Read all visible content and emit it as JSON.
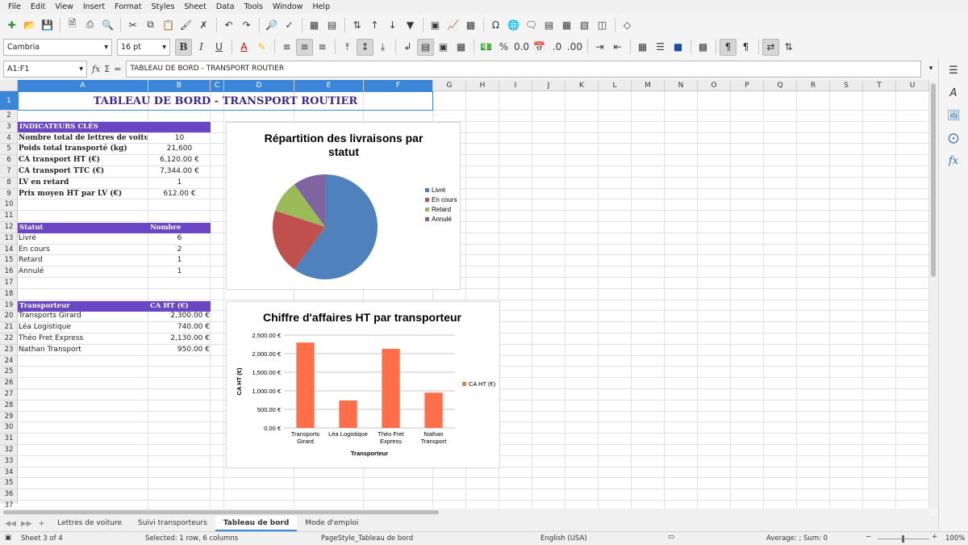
{
  "menu": [
    "File",
    "Edit",
    "View",
    "Insert",
    "Format",
    "Styles",
    "Sheet",
    "Data",
    "Tools",
    "Window",
    "Help"
  ],
  "toolbar2": {
    "font_name": "Cambria",
    "font_size": "16 pt"
  },
  "formula_bar": {
    "name_box": "A1:F1",
    "content": "TABLEAU DE BORD - TRANSPORT ROUTIER"
  },
  "columns": [
    "A",
    "B",
    "C",
    "D",
    "E",
    "F",
    "G",
    "H",
    "I",
    "J",
    "K",
    "L",
    "M",
    "N",
    "O",
    "P",
    "Q",
    "R",
    "S",
    "T",
    "U"
  ],
  "rows": [
    "1",
    "2",
    "3",
    "4",
    "5",
    "6",
    "7",
    "8",
    "9",
    "10",
    "11",
    "12",
    "13",
    "14",
    "15",
    "16",
    "17",
    "18",
    "19",
    "20",
    "21",
    "22",
    "23",
    "24",
    "25",
    "26",
    "27",
    "28",
    "29",
    "30",
    "31",
    "32",
    "33",
    "34",
    "35",
    "36",
    "37"
  ],
  "sheet": {
    "title": "TABLEAU DE BORD - TRANSPORT ROUTIER",
    "indicators_header": "INDICATEURS CLÉS",
    "indicators": [
      {
        "label": "Nombre total de lettres de voiture",
        "value": "10"
      },
      {
        "label": "Poids total transporté (kg)",
        "value": "21,600"
      },
      {
        "label": "CA transport HT (€)",
        "value": "6,120.00 €"
      },
      {
        "label": "CA transport TTC (€)",
        "value": "7,344.00 €"
      },
      {
        "label": "LV en retard",
        "value": "1"
      },
      {
        "label": "Prix moyen HT par LV (€)",
        "value": "612.00 €"
      }
    ],
    "status_header": {
      "col_a": "Statut",
      "col_b": "Nombre"
    },
    "statuses": [
      {
        "label": "Livré",
        "value": "6"
      },
      {
        "label": "En cours",
        "value": "2"
      },
      {
        "label": "Retard",
        "value": "1"
      },
      {
        "label": "Annulé",
        "value": "1"
      }
    ],
    "carrier_header": {
      "col_a": "Transporteur",
      "col_b": "CA HT (€)"
    },
    "carriers": [
      {
        "label": "Transports Girard",
        "value": "2,300.00 €"
      },
      {
        "label": "Léa Logistique",
        "value": "740.00 €"
      },
      {
        "label": "Théo Fret Express",
        "value": "2,130.00 €"
      },
      {
        "label": "Nathan Transport",
        "value": "950.00 €"
      }
    ]
  },
  "chart_data": [
    {
      "type": "pie",
      "title": "Répartition des livraisons par statut",
      "categories": [
        "Livré",
        "En cours",
        "Retard",
        "Annulé"
      ],
      "values": [
        6,
        2,
        1,
        1
      ],
      "colors": [
        "#4f81bd",
        "#c0504d",
        "#9bbb59",
        "#8064a2"
      ],
      "legend": "right"
    },
    {
      "type": "bar",
      "title": "Chiffre d'affaires HT par transporteur",
      "categories": [
        "Transports Girard",
        "Léa Logistique",
        "Théo Fret Express",
        "Nathan Transport"
      ],
      "category_lines": [
        [
          "Transports",
          "Girard"
        ],
        [
          "Léa Logistique"
        ],
        [
          "Théo Fret",
          "Express"
        ],
        [
          "Nathan",
          "Transport"
        ]
      ],
      "series": [
        {
          "name": "CA HT (€)",
          "values": [
            2300,
            740,
            2130,
            950
          ],
          "color": "#ff6e4a"
        }
      ],
      "xlabel": "Transporteur",
      "ylabel": "CA HT (€)",
      "ylim": [
        0,
        2500
      ],
      "yticks": [
        "0.00 €",
        "500.00 €",
        "1,000.00 €",
        "1,500.00 €",
        "2,000.00 €",
        "2,500.00 €"
      ],
      "grid": true,
      "legend": "right"
    }
  ],
  "sheet_tabs": [
    "Lettres de voiture",
    "Suivi transporteurs",
    "Tableau de bord",
    "Mode d'emploi"
  ],
  "active_tab": "Tableau de bord",
  "status_bar": {
    "sheet": "Sheet 3 of 4",
    "selection": "Selected: 1 row, 6 columns",
    "page_style": "PageStyle_Tableau de bord",
    "language": "English (USA)",
    "summary": "Average: ; Sum: 0",
    "zoom": "100%"
  }
}
